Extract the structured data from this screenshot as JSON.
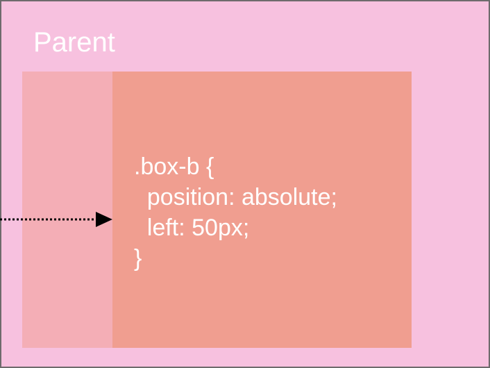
{
  "parent": {
    "label": "Parent"
  },
  "box_b": {
    "code_lines": [
      ".box-b {",
      "  position: absolute;",
      "  left: 50px;",
      "}"
    ]
  },
  "colors": {
    "parent_bg": "#f7c1df",
    "parent_border": "#6e6a6c",
    "ghost_box": "#f4aeb6",
    "box_b": "#f09e90",
    "text": "#ffffff",
    "arrow": "#000000"
  }
}
